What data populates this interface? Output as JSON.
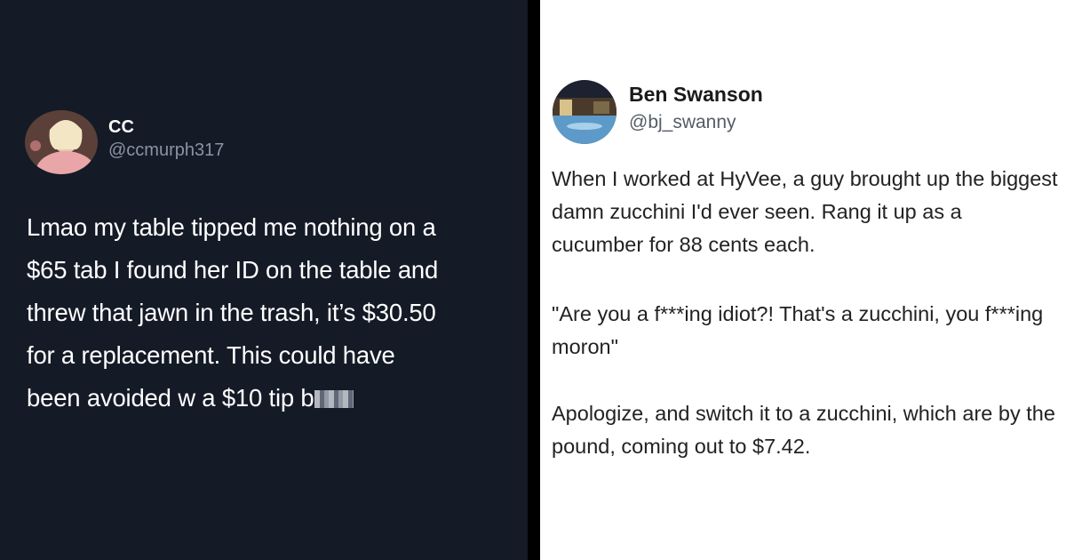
{
  "left_tweet": {
    "display_name": "CC",
    "handle": "@ccmurph317",
    "body": "Lmao my table tipped me nothing on a\n$65 tab I found her ID on the table and\nthrew that jawn in the trash, it’s $30.50\nfor a replacement. This could have\nbeen avoided w a $10 tip b",
    "avatar": "profile-photo",
    "censored_word_icon": "pixelated-censor"
  },
  "right_tweet": {
    "display_name": "Ben Swanson",
    "handle": "@bj_swanny",
    "avatar": "profile-photo-pool",
    "paragraphs": [
      "When I worked at HyVee, a guy brought up the biggest damn zucchini I'd ever seen. Rang it up as a cucumber for 88 cents each.",
      "\"Are you a f***ing idiot?! That's a zucchini, you f***ing moron\"",
      "Apologize, and switch it to a zucchini, which are by the pound, coming out to $7.42."
    ]
  },
  "colors": {
    "left_background": "#141a26",
    "left_text": "#ffffff",
    "left_handle": "#8a94a4",
    "right_background": "#ffffff",
    "right_text": "#222222",
    "right_handle": "#555c66",
    "divider": "#000000"
  }
}
